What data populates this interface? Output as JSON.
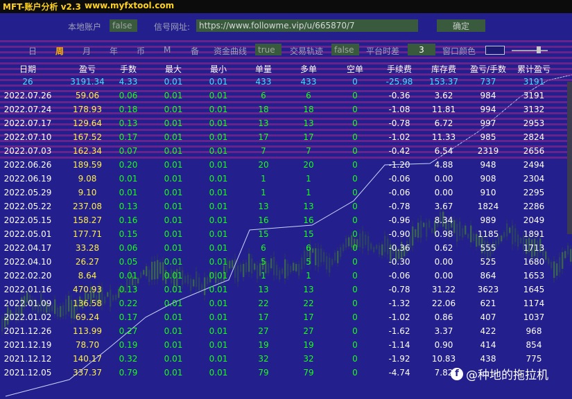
{
  "titlebar": {
    "title": "MFT-账户分析 v2.3",
    "url": "www.myfxtool.com"
  },
  "top": {
    "local_account_label": "本地账户",
    "local_account_value": "false",
    "signal_url_label": "信号网址:",
    "signal_url_value": "https://www.followme.vip/u/665870/7",
    "confirm_label": "确定"
  },
  "toolbar": {
    "periods": [
      "日",
      "周",
      "月",
      "年",
      "币",
      "M",
      "备"
    ],
    "selected_period": "周",
    "equity_curve_label": "资金曲线",
    "equity_curve_value": "true",
    "trade_track_label": "交易轨迹",
    "trade_track_value": "false",
    "platform_offset_label": "平台时差",
    "platform_offset_value": "3",
    "window_color_label": "窗口颜色"
  },
  "colors": {
    "background": "#231f8c",
    "green_values": "#1aff1a",
    "summary_values": "#3ee0ff",
    "yellow_values": "#fff04a",
    "highlight_period": "#ffb400"
  },
  "table": {
    "headers": [
      "日期",
      "盈亏",
      "手数",
      "最大",
      "最小",
      "单量",
      "多单",
      "空单",
      "手续费",
      "库存费",
      "盈亏/手数",
      "累计盈亏"
    ],
    "summary": [
      "26",
      "3191.34",
      "4.33",
      "0.01",
      "0.01",
      "433",
      "433",
      "0",
      "-25.98",
      "153.37",
      "737",
      "3191"
    ],
    "rows": [
      [
        "2022.07.26",
        "59.06",
        "0.06",
        "0.01",
        "0.01",
        "6",
        "6",
        "0",
        "-0.36",
        "3.62",
        "984",
        "3191"
      ],
      [
        "2022.07.24",
        "178.93",
        "0.18",
        "0.01",
        "0.01",
        "18",
        "18",
        "0",
        "-1.08",
        "11.81",
        "994",
        "3132"
      ],
      [
        "2022.07.17",
        "129.64",
        "0.13",
        "0.01",
        "0.01",
        "13",
        "13",
        "0",
        "-0.78",
        "6.72",
        "997",
        "2953"
      ],
      [
        "2022.07.10",
        "167.52",
        "0.17",
        "0.01",
        "0.01",
        "17",
        "17",
        "0",
        "-1.02",
        "11.33",
        "985",
        "2824"
      ],
      [
        "2022.07.03",
        "162.34",
        "0.07",
        "0.01",
        "0.01",
        "7",
        "7",
        "0",
        "-0.42",
        "6.54",
        "2319",
        "2656"
      ],
      [
        "2022.06.26",
        "189.59",
        "0.20",
        "0.01",
        "0.01",
        "20",
        "20",
        "0",
        "-1.20",
        "4.88",
        "948",
        "2494"
      ],
      [
        "2022.06.19",
        "9.08",
        "0.01",
        "0.01",
        "0.01",
        "1",
        "1",
        "0",
        "-0.06",
        "0.00",
        "908",
        "2304"
      ],
      [
        "2022.05.29",
        "9.10",
        "0.01",
        "0.01",
        "0.01",
        "1",
        "1",
        "0",
        "-0.06",
        "0.00",
        "910",
        "2295"
      ],
      [
        "2022.05.22",
        "237.08",
        "0.13",
        "0.01",
        "0.01",
        "13",
        "13",
        "0",
        "-0.78",
        "3.67",
        "1824",
        "2286"
      ],
      [
        "2022.05.15",
        "158.27",
        "0.16",
        "0.01",
        "0.01",
        "16",
        "16",
        "0",
        "-0.96",
        "8.34",
        "989",
        "2049"
      ],
      [
        "2022.05.01",
        "177.71",
        "0.15",
        "0.01",
        "0.01",
        "15",
        "15",
        "0",
        "-0.90",
        "0.98",
        "1185",
        "1891"
      ],
      [
        "2022.04.17",
        "33.28",
        "0.06",
        "0.01",
        "0.01",
        "6",
        "6",
        "0",
        "-0.36",
        "0.62",
        "555",
        "1713"
      ],
      [
        "2022.04.10",
        "26.27",
        "0.05",
        "0.01",
        "0.01",
        "5",
        "5",
        "0",
        "-0.30",
        "0.00",
        "525",
        "1680"
      ],
      [
        "2022.02.20",
        "8.64",
        "0.01",
        "0.01",
        "0.01",
        "1",
        "1",
        "0",
        "-0.06",
        "0.00",
        "864",
        "1653"
      ],
      [
        "2022.01.16",
        "470.93",
        "0.13",
        "0.01",
        "0.01",
        "13",
        "13",
        "0",
        "-0.78",
        "31.22",
        "3623",
        "1645"
      ],
      [
        "2022.01.09",
        "136.58",
        "0.22",
        "0.01",
        "0.01",
        "22",
        "22",
        "0",
        "-1.32",
        "22.06",
        "621",
        "1174"
      ],
      [
        "2022.01.02",
        "69.24",
        "0.17",
        "0.01",
        "0.01",
        "17",
        "17",
        "0",
        "-1.02",
        "0.86",
        "407",
        "1037"
      ],
      [
        "2021.12.26",
        "113.99",
        "0.27",
        "0.01",
        "0.01",
        "27",
        "27",
        "0",
        "-1.62",
        "3.37",
        "422",
        "968"
      ],
      [
        "2021.12.19",
        "78.70",
        "0.19",
        "0.01",
        "0.01",
        "19",
        "19",
        "0",
        "-1.14",
        "0.90",
        "414",
        "854"
      ],
      [
        "2021.12.12",
        "140.17",
        "0.32",
        "0.01",
        "0.01",
        "32",
        "32",
        "0",
        "-1.92",
        "10.83",
        "438",
        "775"
      ],
      [
        "2021.12.05",
        "337.37",
        "0.79",
        "0.01",
        "0.01",
        "79",
        "79",
        "0",
        "-4.74",
        "7.82",
        "",
        ""
      ]
    ]
  },
  "watermark": {
    "text": "@种地的拖拉机"
  }
}
